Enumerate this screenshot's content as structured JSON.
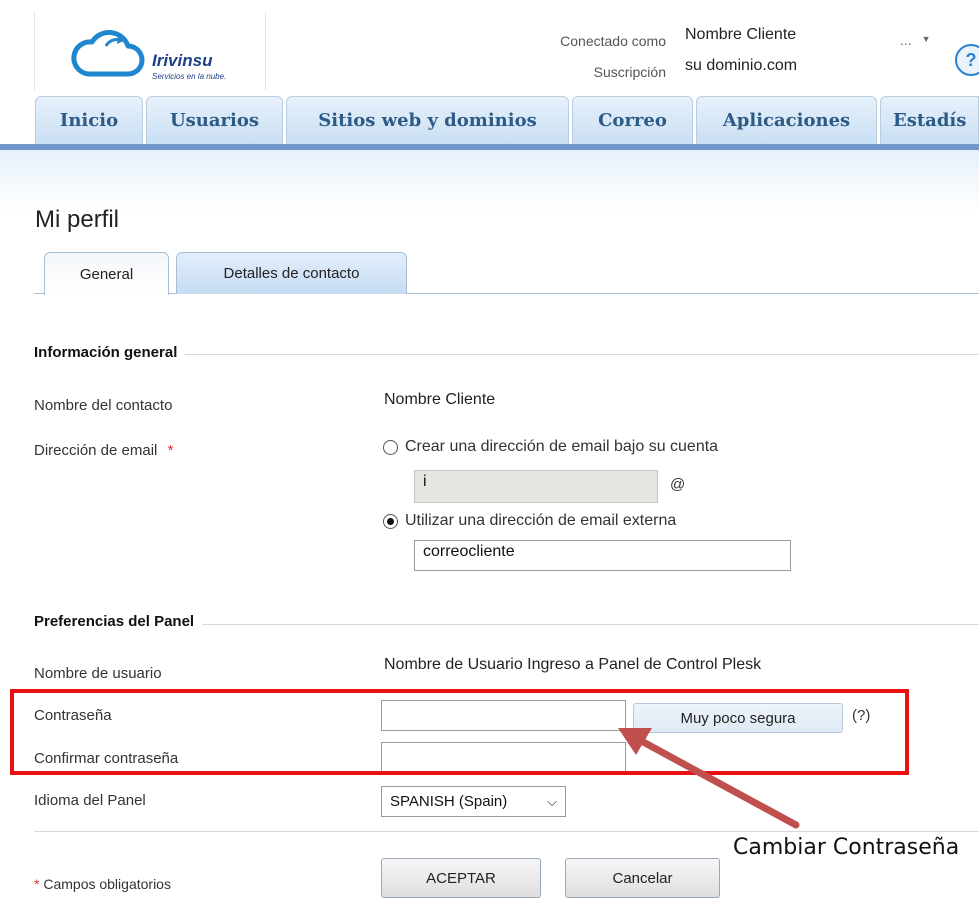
{
  "header": {
    "brand": "Irivinsu",
    "tagline": "Servicios en la nube.",
    "connected_label": "Conectado como",
    "connected_value": "Nombre Cliente",
    "subscription_label": "Suscripción",
    "subscription_value": "su dominio.com",
    "more": "...",
    "help_icon": "?"
  },
  "nav": {
    "tabs": [
      "Inicio",
      "Usuarios",
      "Sitios web y dominios",
      "Correo",
      "Aplicaciones",
      "Estadís"
    ]
  },
  "page": {
    "title": "Mi perfil",
    "tabs": [
      "General",
      "Detalles de contacto"
    ]
  },
  "general": {
    "section_title": "Información general",
    "contact_name_label": "Nombre del contacto",
    "contact_name_value": "Nombre Cliente",
    "email_label": "Dirección de email",
    "required_mark": "*",
    "option_internal": "Crear una dirección de email bajo su cuenta",
    "internal_value": "i",
    "at_sign": "@",
    "option_external": "Utilizar una dirección de email externa",
    "external_value": "correocliente"
  },
  "panel": {
    "section_title": "Preferencias del Panel",
    "username_label": "Nombre de usuario",
    "username_value": "Nombre de Usuario Ingreso a Panel de Control Plesk",
    "password_label": "Contraseña",
    "strength": "Muy poco segura",
    "help": "(?)",
    "confirm_label": "Confirmar contraseña",
    "language_label": "Idioma del Panel",
    "language_value": "SPANISH (Spain)"
  },
  "footer": {
    "required_mark": "*",
    "required_note": "Campos obligatorios",
    "ok": "ACEPTAR",
    "cancel": "Cancelar"
  },
  "annotation": {
    "text": "Cambiar Contraseña",
    "color": "#e81010",
    "arrow_color": "#c0504d"
  }
}
